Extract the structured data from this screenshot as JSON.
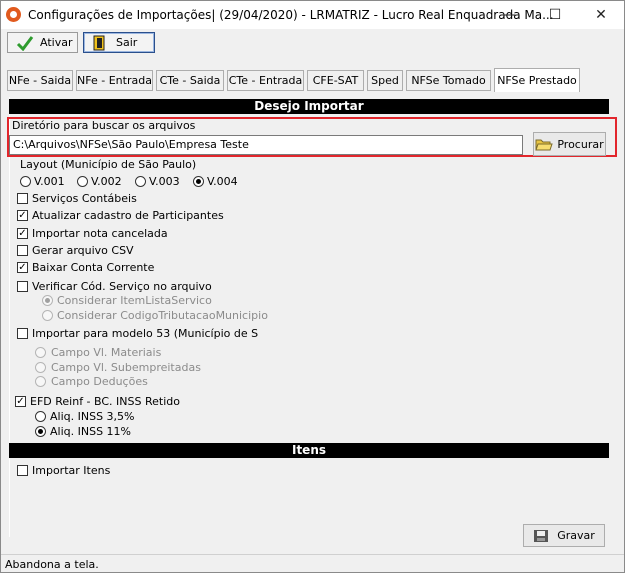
{
  "window": {
    "title": "Configurações de Importações| (29/04/2020) - LRMATRIZ - Lucro Real Enquadrada Ma...",
    "controls": {
      "minimize": "—",
      "maximize": "☐",
      "close": "✕"
    }
  },
  "toolbar": {
    "ativar": "Ativar",
    "sair": "Sair"
  },
  "tabs": [
    {
      "label": "NFe - Saida"
    },
    {
      "label": "NFe - Entrada"
    },
    {
      "label": "CTe - Saida"
    },
    {
      "label": "CTe - Entrada"
    },
    {
      "label": "CFE-SAT"
    },
    {
      "label": "Sped"
    },
    {
      "label": "NFSe Tomado"
    },
    {
      "label": "NFSe Prestado",
      "active": true
    }
  ],
  "section_import": "Desejo Importar",
  "directory": {
    "label": "Diretório para buscar os arquivos",
    "value": "C:\\Arquivos\\NFSe\\São Paulo\\Empresa Teste",
    "browse_label": "Procurar"
  },
  "layout": {
    "label": "Layout (Município de São Paulo)",
    "options": [
      "V.001",
      "V.002",
      "V.003",
      "V.004"
    ],
    "selected": "V.004"
  },
  "checks": {
    "servicos_contabeis": {
      "label": "Serviços Contábeis",
      "checked": false
    },
    "atualizar_participantes": {
      "label": "Atualizar cadastro de Participantes",
      "checked": true
    },
    "importar_cancelada": {
      "label": "Importar nota cancelada",
      "checked": true
    },
    "gerar_csv": {
      "label": "Gerar arquivo CSV",
      "checked": false
    },
    "baixar_conta": {
      "label": "Baixar Conta Corrente",
      "checked": true
    },
    "verificar_servico": {
      "label": "Verificar Cód. Serviço no arquivo",
      "checked": false
    },
    "importar_modelo53": {
      "label": "Importar para modelo 53 (Município de S",
      "checked": false
    },
    "efd_reinf": {
      "label": "EFD Reinf - BC. INSS Retido",
      "checked": true
    }
  },
  "verificar_options": [
    "Considerar ItemListaServico",
    "Considerar CodigoTributacaoMunicipio"
  ],
  "modelo53_options": [
    "Campo Vl. Materiais",
    "Campo Vl. Subempreitadas",
    "Campo Deduções"
  ],
  "inss_options": [
    "Aliq. INSS 3,5%",
    "Aliq. INSS 11%"
  ],
  "inss_selected": "Aliq. INSS 11%",
  "section_itens": "Itens",
  "importar_itens": {
    "label": "Importar Itens",
    "checked": false
  },
  "gravar_label": "Gravar",
  "status": "Abandona a tela.",
  "colors": {
    "highlight_border": "#e2262c",
    "section_bg": "#000000"
  }
}
